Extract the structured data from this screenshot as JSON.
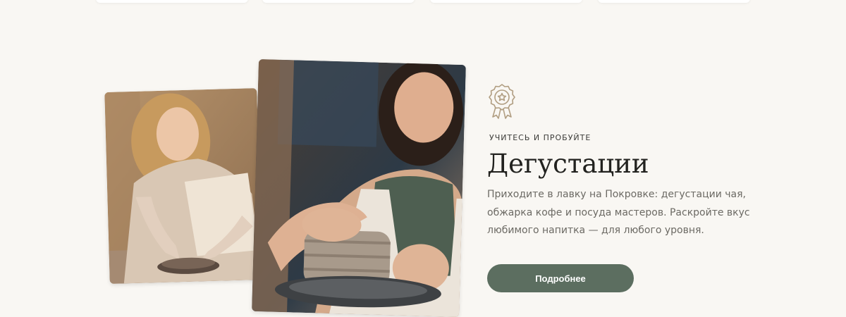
{
  "section": {
    "eyebrow": "УЧИТЕСЬ И ПРОБУЙТЕ",
    "title": "Дегустации",
    "description": "Приходите в лавку на Покровке: дегустации чая, обжарка кофе и посуда мастеров. Раскройте вкус любимого напитка — для любого уровня.",
    "button_label": "Подробнее",
    "icon": "award-badge-icon"
  },
  "images": {
    "left": "woman-shaping-clay-bowl",
    "right": "woman-at-pottery-wheel"
  },
  "colors": {
    "background": "#f9f7f3",
    "accent_button": "#5c6e60",
    "icon_stroke": "#b19e82",
    "title_text": "#22221f",
    "body_text": "#6c6a64"
  }
}
